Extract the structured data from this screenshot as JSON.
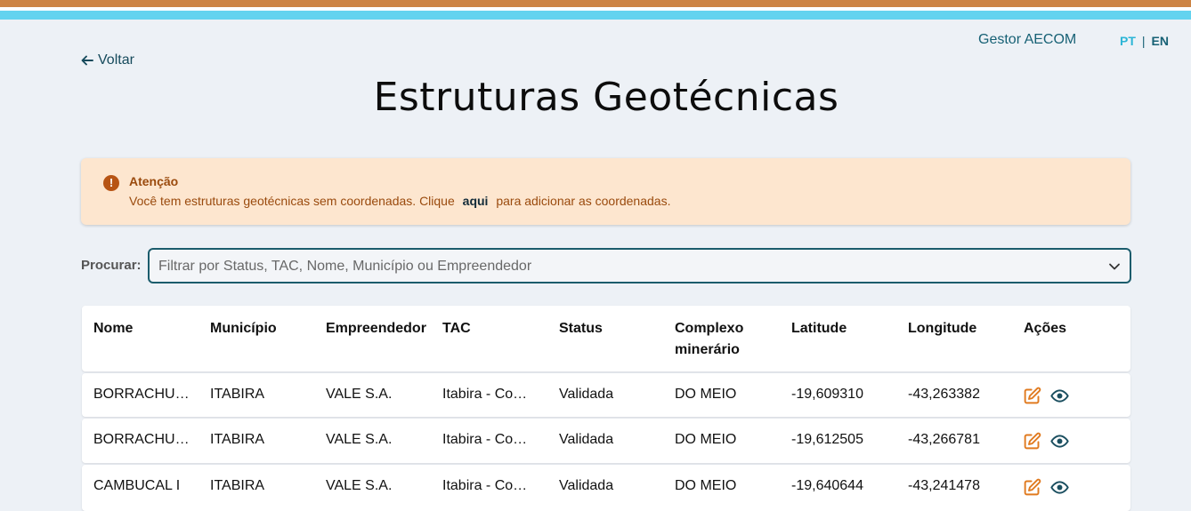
{
  "header": {
    "user": "Gestor AECOM",
    "lang_pt": "PT",
    "lang_sep": "|",
    "lang_en": "EN"
  },
  "nav": {
    "back_label": "Voltar"
  },
  "page": {
    "title": "Estruturas Geotécnicas"
  },
  "alert": {
    "title": "Atenção",
    "message_before": "Você tem estruturas geotécnicas sem coordenadas. Clique",
    "link": "aqui",
    "message_after": "para adicionar as coordenadas."
  },
  "search": {
    "label": "Procurar:",
    "placeholder": "Filtrar por Status, TAC, Nome, Município ou Empreendedor",
    "value": ""
  },
  "table": {
    "headers": [
      "Nome",
      "Município",
      "Empreendedor",
      "TAC",
      "Status",
      "Complexo minerário",
      "Latitude",
      "Longitude",
      "Ações"
    ],
    "rows": [
      [
        "BORRACHUDO",
        "ITABIRA",
        "VALE S.A.",
        "Itabira - Complexo",
        "Validada",
        "DO MEIO",
        "-19,609310",
        "-43,263382"
      ],
      [
        "BORRACHUDO II",
        "ITABIRA",
        "VALE S.A.",
        "Itabira - Complexo",
        "Validada",
        "DO MEIO",
        "-19,612505",
        "-43,266781"
      ],
      [
        "CAMBUCAL I",
        "ITABIRA",
        "VALE S.A.",
        "Itabira - Complexo",
        "Validada",
        "DO MEIO",
        "-19,640644",
        "-43,241478"
      ]
    ]
  },
  "colors": {
    "stripe_orange": "#cd8444",
    "stripe_blue": "#63d3ef",
    "alert_bg": "#fde6cf",
    "alert_text": "#9a4a0d",
    "edit_icon": "#e07a1f",
    "view_icon": "#1b4f60"
  },
  "icons": {
    "back": "arrow-left-icon",
    "alert": "exclamation-circle-icon",
    "dropdown": "chevron-down-icon",
    "edit": "edit-icon",
    "view": "eye-icon"
  }
}
